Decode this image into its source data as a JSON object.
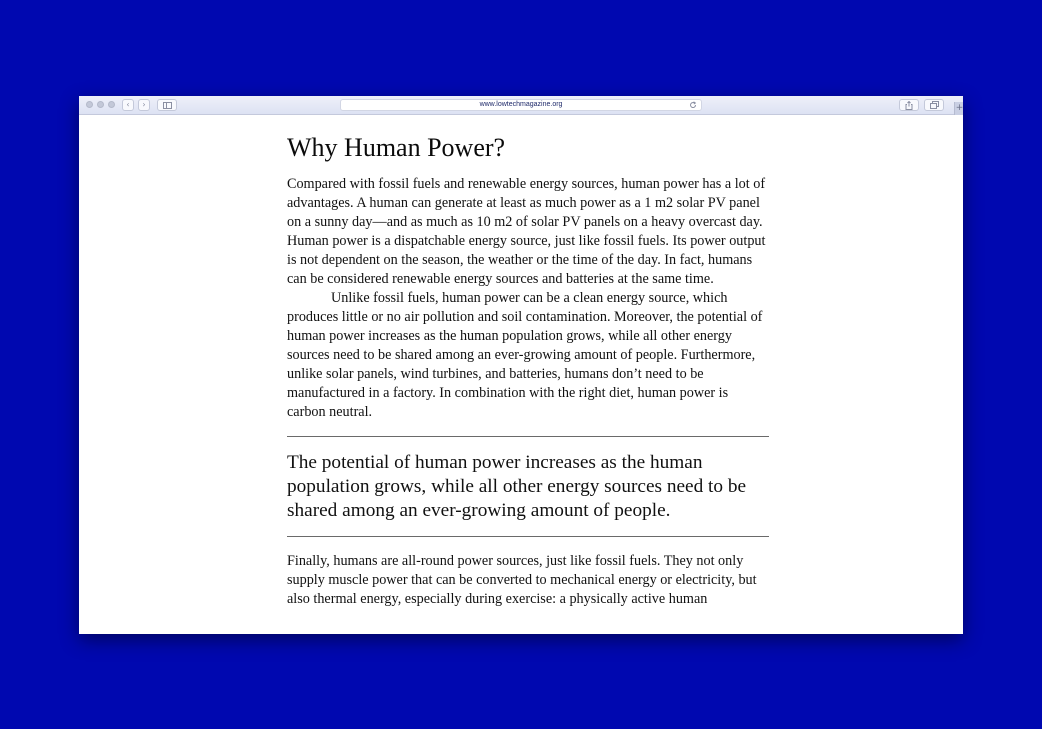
{
  "browser": {
    "url": "www.lowtechmagazine.org",
    "back_label": "‹",
    "forward_label": "›",
    "new_tab_label": "+",
    "icons": [
      "close-dot",
      "minimize-dot",
      "zoom-dot",
      "back-icon",
      "forward-icon",
      "sidebar-icon",
      "reload-icon",
      "share-icon",
      "tabs-icon",
      "plus-icon"
    ]
  },
  "article": {
    "heading": "Why Human Power?",
    "paragraph1": "Compared with fossil fuels and renewable energy sources, human power has a lot of advantages. A human can generate at least as much power as a 1 m2 solar PV panel on a sunny day—and as much as 10 m2 of solar PV panels on a heavy overcast day. Human power is a dispatchable energy source, just like fossil fuels. Its power output is not dependent on the season, the weather or the time of the day. In fact, humans can be considered renewable energy sources and batteries at the same time.",
    "paragraph2": "Unlike fossil fuels, human power can be a clean energy source, which produces little or no air pollution and soil contamination. Moreover, the potential of human power increases as the human population grows, while all other energy sources need to be shared among an ever-growing amount of people. Furthermore, unlike solar panels, wind turbines, and batteries, humans don’t need to be manufactured in a factory. In combination with the right diet, human power is carbon neutral.",
    "pull_quote": "The potential of human power increases as the human population grows, while all other energy sources need to be shared among an ever-growing amount of people.",
    "paragraph3": "Finally, humans are all-round power sources, just like fossil fuels. They not only supply muscle power that can be converted to mechanical energy or electricity, but also thermal energy, especially during exercise: a physically active human"
  }
}
